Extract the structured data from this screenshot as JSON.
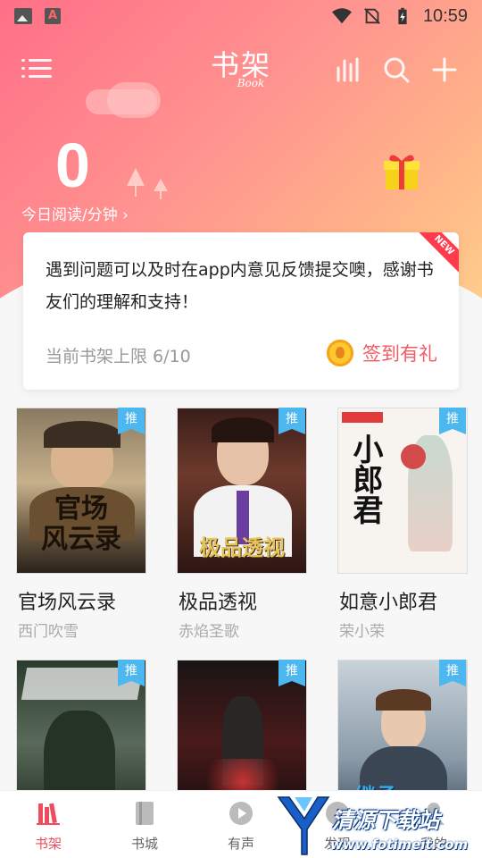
{
  "status_bar": {
    "time": "10:59"
  },
  "header": {
    "title": "书架",
    "subtitle": "Book"
  },
  "today": {
    "minutes": "0",
    "label": "今日阅读/分钟 ›"
  },
  "notice": {
    "message": "遇到问题可以及时在app内意见反馈提交噢，感谢书友们的理解和支持！",
    "shelf_limit": "当前书架上限 6/10",
    "checkin_label": "签到有礼",
    "new_tag": "NEW"
  },
  "books": [
    {
      "title": "官场风云录",
      "author": "西门吹雪",
      "badge": "推",
      "cover_title": "官场\n风云录"
    },
    {
      "title": "极品透视",
      "author": "赤焰圣歌",
      "badge": "推",
      "cover_title": "极品透视"
    },
    {
      "title": "如意小郎君",
      "author": "荣小荣",
      "badge": "推",
      "cover_title": "小郎君"
    },
    {
      "title": "",
      "author": "",
      "badge": "推",
      "cover_title": ""
    },
    {
      "title": "",
      "author": "",
      "badge": "推",
      "cover_title": ""
    },
    {
      "title": "",
      "author": "",
      "badge": "推",
      "cover_title": "继承"
    }
  ],
  "tabs": [
    {
      "label": "书架",
      "icon": "bookshelf-icon",
      "active": true
    },
    {
      "label": "书城",
      "icon": "bookstore-icon",
      "active": false
    },
    {
      "label": "有声",
      "icon": "audio-icon",
      "active": false
    },
    {
      "label": "发现",
      "icon": "discover-icon",
      "active": false
    },
    {
      "label": "我的",
      "icon": "profile-icon",
      "active": false
    }
  ],
  "watermark": {
    "name": "清源下载站",
    "url": "www.fotimeit.com"
  },
  "colors": {
    "accent": "#f04b5f",
    "hero_start": "#ff6f87",
    "hero_end": "#ffcf8c",
    "badge": "#4db8f0"
  }
}
